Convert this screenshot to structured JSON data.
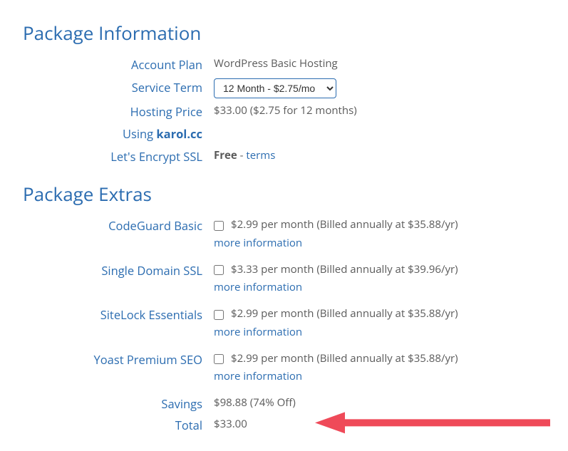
{
  "package_info": {
    "heading": "Package Information",
    "account_plan_label": "Account Plan",
    "account_plan_value": "WordPress Basic Hosting",
    "service_term_label": "Service Term",
    "service_term_selected": "12 Month - $2.75/mo",
    "hosting_price_label": "Hosting Price",
    "hosting_price_value": "$33.00 ($2.75 for 12 months)",
    "using_label_prefix": "Using",
    "using_domain": "karol.cc",
    "ssl_label": "Let's Encrypt SSL",
    "ssl_value": "Free",
    "ssl_dash": " - ",
    "ssl_terms": "terms"
  },
  "package_extras": {
    "heading": "Package Extras",
    "more_info": "more information",
    "items": [
      {
        "label": "CodeGuard Basic",
        "price_text": "$2.99 per month (Billed annually at $35.88/yr)"
      },
      {
        "label": "Single Domain SSL",
        "price_text": "$3.33 per month (Billed annually at $39.96/yr)"
      },
      {
        "label": "SiteLock Essentials",
        "price_text": "$2.99 per month (Billed annually at $35.88/yr)"
      },
      {
        "label": "Yoast Premium SEO",
        "price_text": "$2.99 per month (Billed annually at $35.88/yr)"
      }
    ],
    "savings_label": "Savings",
    "savings_value": "$98.88 (74% Off)",
    "total_label": "Total",
    "total_value": "$33.00"
  }
}
